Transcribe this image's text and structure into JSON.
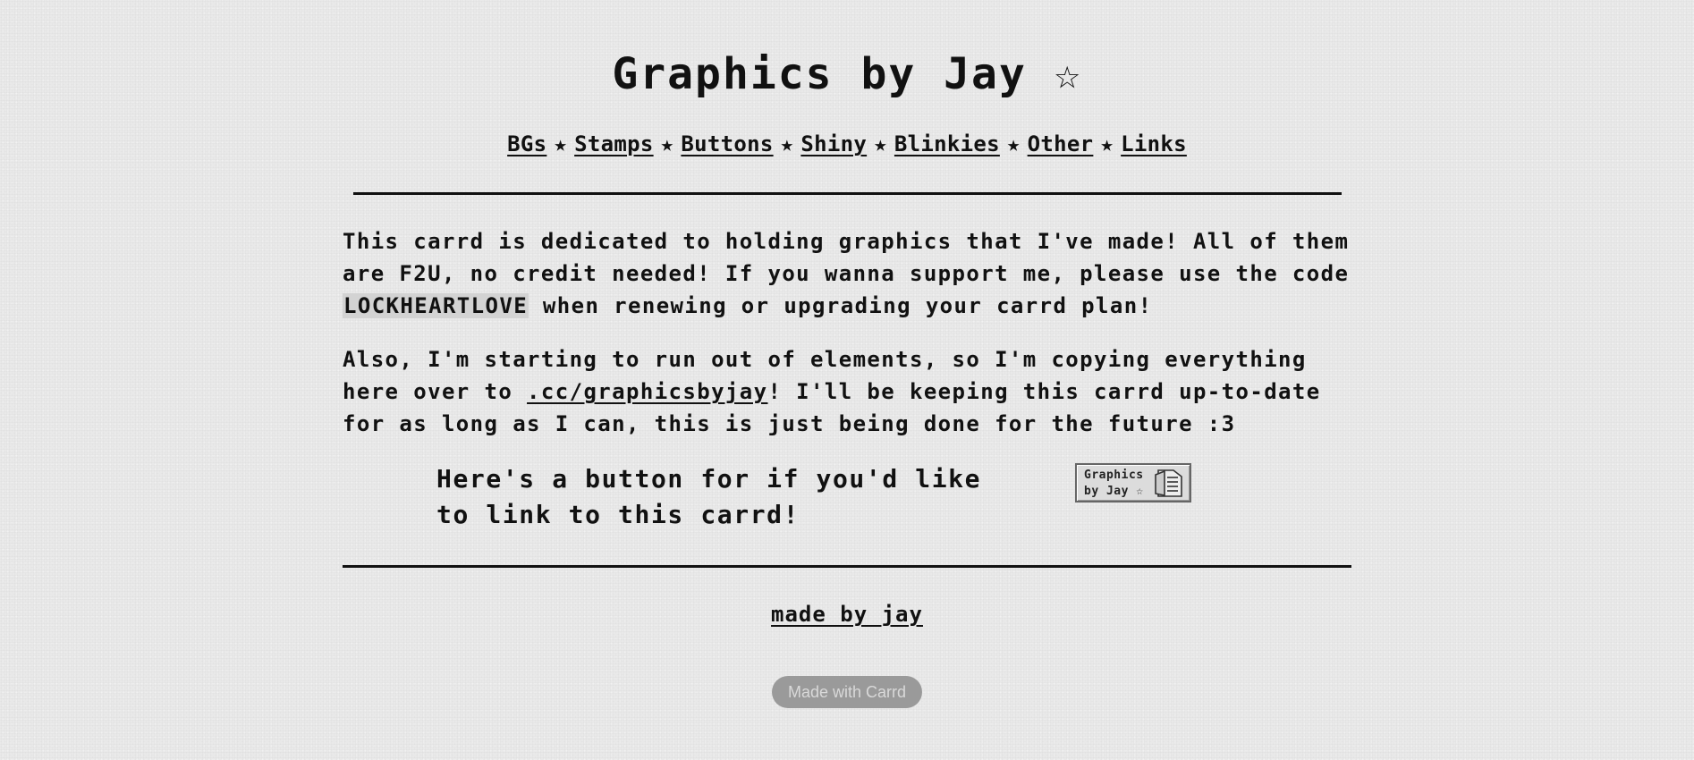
{
  "header": {
    "title": "Graphics by Jay ☆"
  },
  "nav": {
    "items": [
      {
        "label": "BGs"
      },
      {
        "label": "Stamps"
      },
      {
        "label": "Buttons"
      },
      {
        "label": "Shiny"
      },
      {
        "label": "Blinkies"
      },
      {
        "label": "Other"
      },
      {
        "label": "Links"
      }
    ],
    "separator": "★"
  },
  "intro": {
    "text_before_code": "This carrd is dedicated to holding graphics that I've made! All of them are F2U, no credit needed! If you wanna support me, please use the code ",
    "code": "LOCKHEARTLOVE",
    "text_after_code": " when renewing or upgrading your carrd plan!"
  },
  "notice": {
    "text_before_link": "Also, I'm starting to run out of elements, so I'm copying everything here over to ",
    "link_label": ".cc/graphicsbyjay",
    "text_after_link": "! I'll be keeping this carrd up-to-date for as long as I can, this is just being done for the future :3"
  },
  "button_section": {
    "text": "Here's a button for if you'd like to link to this carrd!",
    "button_image_text": "Graphics by Jay ☆",
    "button_icon": "document-icon"
  },
  "footer": {
    "made_by_label": "made by jay",
    "carrd_badge_label": "Made with Carrd"
  },
  "colors": {
    "background": "#e9e9e9",
    "text": "#111111",
    "code_highlight": "#d3d3d3",
    "badge_background": "#9a9a9a",
    "badge_text": "#d9d9d9"
  }
}
